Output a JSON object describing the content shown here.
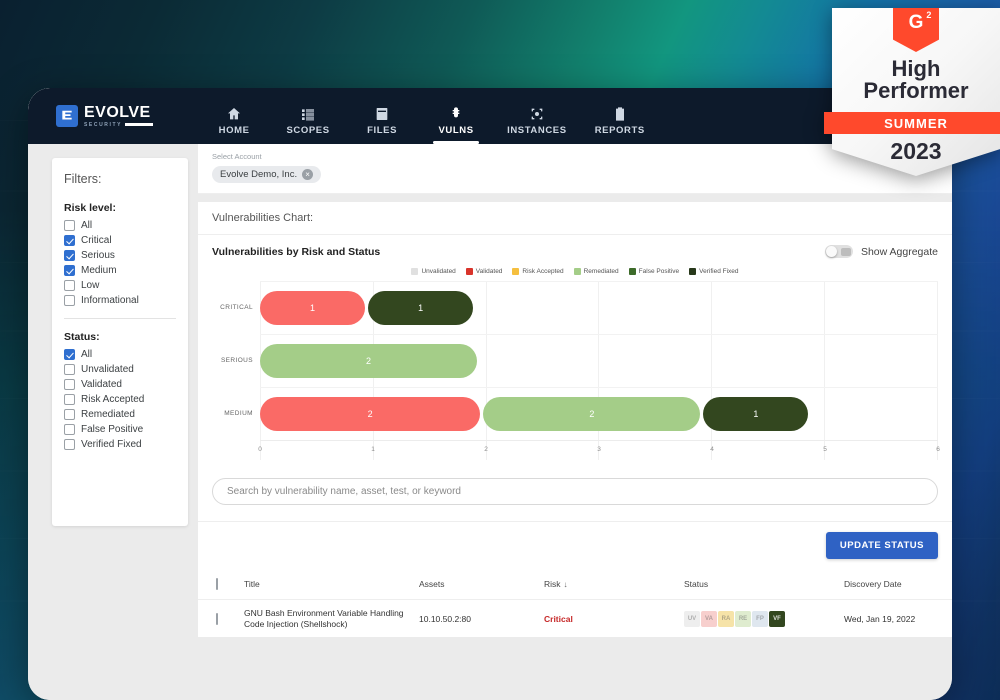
{
  "brand": {
    "logo_text": "EVOLVE",
    "logo_sub": "SECURITY",
    "logo_mark": "evolve-logo-icon"
  },
  "nav": {
    "items": [
      {
        "label": "HOME",
        "icon": "home-icon",
        "active": false
      },
      {
        "label": "SCOPES",
        "icon": "list-icon",
        "active": false
      },
      {
        "label": "FILES",
        "icon": "file-icon",
        "active": false
      },
      {
        "label": "VULNS",
        "icon": "bug-icon",
        "active": true
      },
      {
        "label": "INSTANCES",
        "icon": "target-icon",
        "active": false
      },
      {
        "label": "REPORTS",
        "icon": "clipboard-icon",
        "active": false
      }
    ]
  },
  "sidebar": {
    "title": "Filters:",
    "risk_group_title": "Risk level:",
    "risk_items": [
      {
        "label": "All",
        "checked": false
      },
      {
        "label": "Critical",
        "checked": true
      },
      {
        "label": "Serious",
        "checked": true
      },
      {
        "label": "Medium",
        "checked": true
      },
      {
        "label": "Low",
        "checked": false
      },
      {
        "label": "Informational",
        "checked": false
      }
    ],
    "status_group_title": "Status:",
    "status_items": [
      {
        "label": "All",
        "checked": true
      },
      {
        "label": "Unvalidated",
        "checked": false
      },
      {
        "label": "Validated",
        "checked": false
      },
      {
        "label": "Risk Accepted",
        "checked": false
      },
      {
        "label": "Remediated",
        "checked": false
      },
      {
        "label": "False Positive",
        "checked": false
      },
      {
        "label": "Verified Fixed",
        "checked": false
      }
    ]
  },
  "account": {
    "label": "Select Account",
    "chip_value": "Evolve Demo, Inc.",
    "chip_remove": "×"
  },
  "chart_panel": {
    "header": "Vulnerabilities Chart:",
    "aggregate_label": "Show Aggregate",
    "aggregate_on": false
  },
  "chart_data": {
    "type": "bar",
    "orientation": "horizontal",
    "stacked": true,
    "title": "Vulnerabilities by Risk and Status",
    "xlabel": "",
    "ylabel": "",
    "categories": [
      "CRITICAL",
      "SERIOUS",
      "MEDIUM"
    ],
    "xticks": [
      "0",
      "1",
      "2",
      "3",
      "4",
      "5",
      "6"
    ],
    "xlim": [
      0,
      6
    ],
    "grid": true,
    "legend_position": "top-center",
    "series": [
      {
        "name": "Unvalidated",
        "color": "#e0e0e0",
        "values": [
          0,
          0,
          0
        ]
      },
      {
        "name": "Validated",
        "color": "#fa6a66",
        "values": [
          1,
          0,
          2
        ]
      },
      {
        "name": "Risk Accepted",
        "color": "#f5c243",
        "values": [
          0,
          0,
          0
        ]
      },
      {
        "name": "Remediated",
        "color": "#a4cd88",
        "values": [
          0,
          2,
          2
        ]
      },
      {
        "name": "False Positive",
        "color": "#3d6b2a",
        "values": [
          0,
          0,
          0
        ]
      },
      {
        "name": "Verified Fixed",
        "color": "#33471f",
        "values": [
          1,
          0,
          1
        ]
      }
    ],
    "bar_segments": [
      {
        "category": "CRITICAL",
        "segments": [
          {
            "series": "Validated",
            "value": 1,
            "label": "1",
            "color": "#fa6a66"
          },
          {
            "series": "Verified Fixed",
            "value": 1,
            "label": "1",
            "color": "#33471f"
          }
        ]
      },
      {
        "category": "SERIOUS",
        "segments": [
          {
            "series": "Remediated",
            "value": 2,
            "label": "2",
            "color": "#a4cd88"
          }
        ]
      },
      {
        "category": "MEDIUM",
        "segments": [
          {
            "series": "Validated",
            "value": 2,
            "label": "2",
            "color": "#fa6a66"
          },
          {
            "series": "Remediated",
            "value": 2,
            "label": "2",
            "color": "#a4cd88"
          },
          {
            "series": "Verified Fixed",
            "value": 1,
            "label": "1",
            "color": "#33471f"
          }
        ]
      }
    ]
  },
  "search": {
    "placeholder": "Search by vulnerability name, asset, test, or keyword",
    "value": ""
  },
  "toolbar": {
    "update_status_label": "UPDATE STATUS"
  },
  "table": {
    "columns": [
      "Title",
      "Assets",
      "Risk",
      "Status",
      "Discovery Date"
    ],
    "sort_column": "Risk",
    "sort_arrow": "↓",
    "rows": [
      {
        "title": "GNU Bash Environment Variable Handling Code Injection (Shellshock)",
        "assets": "10.10.50.2:80",
        "risk": "Critical",
        "risk_color": "#c62828",
        "status_badges": [
          {
            "code": "UV",
            "color": "#eeeeee",
            "selected": false
          },
          {
            "code": "VA",
            "color": "#f7cfcd",
            "selected": false
          },
          {
            "code": "RA",
            "color": "#f6e3a8",
            "selected": false
          },
          {
            "code": "RE",
            "color": "#dfeccf",
            "selected": false
          },
          {
            "code": "FP",
            "color": "#dfe7ef",
            "selected": false
          },
          {
            "code": "VF",
            "color": "#33471f",
            "selected": true
          }
        ],
        "discovery_date": "Wed, Jan 19, 2022"
      }
    ]
  },
  "g2_badge": {
    "logo": "G",
    "logo_sup": "2",
    "line1": "High",
    "line2": "Performer",
    "season": "SUMMER",
    "year": "2023",
    "accent_color": "#ff492c"
  }
}
